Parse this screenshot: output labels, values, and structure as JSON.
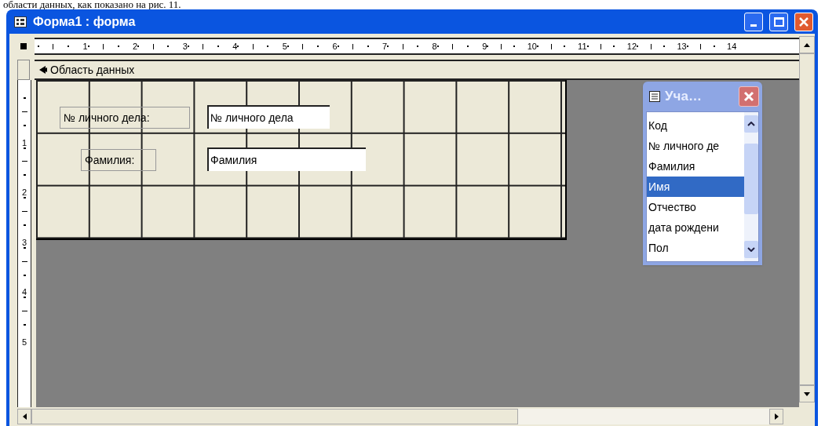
{
  "caption": "области данных, как показано на рис. 11.",
  "window": {
    "title": "Форма1 : форма"
  },
  "ruler": [
    "1",
    "2",
    "3",
    "4",
    "5",
    "6",
    "7",
    "8",
    "9",
    "10",
    "11",
    "12",
    "13",
    "14"
  ],
  "vruler": [
    "1",
    "2",
    "3",
    "4",
    "5"
  ],
  "section": {
    "title": "Область данных"
  },
  "controls": [
    {
      "label": "№ личного дела:",
      "field": "№ личного дела"
    },
    {
      "label": "Фамилия:",
      "field": "Фамилия"
    }
  ],
  "field_list": {
    "title": "Уча…",
    "items": [
      {
        "label": "Код",
        "selected": false
      },
      {
        "label": "№ личного де",
        "selected": false
      },
      {
        "label": "Фамилия",
        "selected": false
      },
      {
        "label": "Имя",
        "selected": true
      },
      {
        "label": "Отчество",
        "selected": false
      },
      {
        "label": "дата рождени",
        "selected": false
      },
      {
        "label": "Пол",
        "selected": false
      }
    ]
  }
}
